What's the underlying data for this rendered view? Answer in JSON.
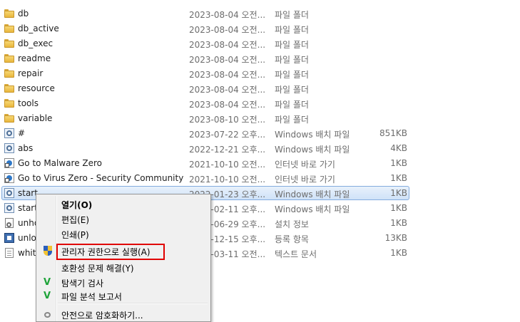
{
  "files": [
    {
      "name": "db",
      "date": "2023-08-04 오전...",
      "type": "파일 폴더",
      "size": "",
      "icon": "folder-icon"
    },
    {
      "name": "db_active",
      "date": "2023-08-04 오전...",
      "type": "파일 폴더",
      "size": "",
      "icon": "folder-icon"
    },
    {
      "name": "db_exec",
      "date": "2023-08-04 오전...",
      "type": "파일 폴더",
      "size": "",
      "icon": "folder-icon"
    },
    {
      "name": "readme",
      "date": "2023-08-04 오전...",
      "type": "파일 폴더",
      "size": "",
      "icon": "folder-icon"
    },
    {
      "name": "repair",
      "date": "2023-08-04 오전...",
      "type": "파일 폴더",
      "size": "",
      "icon": "folder-icon"
    },
    {
      "name": "resource",
      "date": "2023-08-04 오전...",
      "type": "파일 폴더",
      "size": "",
      "icon": "folder-icon"
    },
    {
      "name": "tools",
      "date": "2023-08-04 오전...",
      "type": "파일 폴더",
      "size": "",
      "icon": "folder-icon"
    },
    {
      "name": "variable",
      "date": "2023-08-10 오전...",
      "type": "파일 폴더",
      "size": "",
      "icon": "folder-icon"
    },
    {
      "name": "#",
      "date": "2023-07-22 오후...",
      "type": "Windows 배치 파일",
      "size": "851KB",
      "icon": "batch-file-icon"
    },
    {
      "name": "abs",
      "date": "2022-12-21 오후...",
      "type": "Windows 배치 파일",
      "size": "4KB",
      "icon": "batch-file-icon"
    },
    {
      "name": "Go to Malware Zero",
      "date": "2021-10-10 오전...",
      "type": "인터넷 바로 가기",
      "size": "1KB",
      "icon": "internet-shortcut-icon"
    },
    {
      "name": "Go to Virus Zero - Security Community",
      "date": "2021-10-10 오전...",
      "type": "인터넷 바로 가기",
      "size": "1KB",
      "icon": "internet-shortcut-icon"
    },
    {
      "name": "start",
      "date": "2022-01-23 오후...",
      "type": "Windows 배치 파일",
      "size": "1KB",
      "icon": "batch-file-icon"
    },
    {
      "name": "start.",
      "date": "2022-02-11 오후...",
      "type": "Windows 배치 파일",
      "size": "1KB",
      "icon": "batch-file-icon"
    },
    {
      "name": "unho",
      "date": "2022-06-29 오후...",
      "type": "설치 정보",
      "size": "1KB",
      "icon": "setup-info-icon"
    },
    {
      "name": "unlo",
      "date": "2022-12-15 오후...",
      "type": "등록 항목",
      "size": "13KB",
      "icon": "registry-file-icon"
    },
    {
      "name": "white",
      "date": "2023-03-11 오전...",
      "type": "텍스트 문서",
      "size": "1KB",
      "icon": "text-file-icon"
    }
  ],
  "context_menu": {
    "open": "열기(O)",
    "edit": "편집(E)",
    "print": "인쇄(P)",
    "run_as_admin": "관리자 권한으로 실행(A)",
    "troubleshoot": "호환성 문제 해결(Y)",
    "explorer_scan": "탐색기 검사",
    "file_report": "파일 분석 보고서",
    "next_item": "안전으로 암호화하기..."
  },
  "colors": {
    "selection_border": "#84acdd",
    "highlight_box": "#e00000",
    "vaccine_green": "#1fa33a"
  }
}
